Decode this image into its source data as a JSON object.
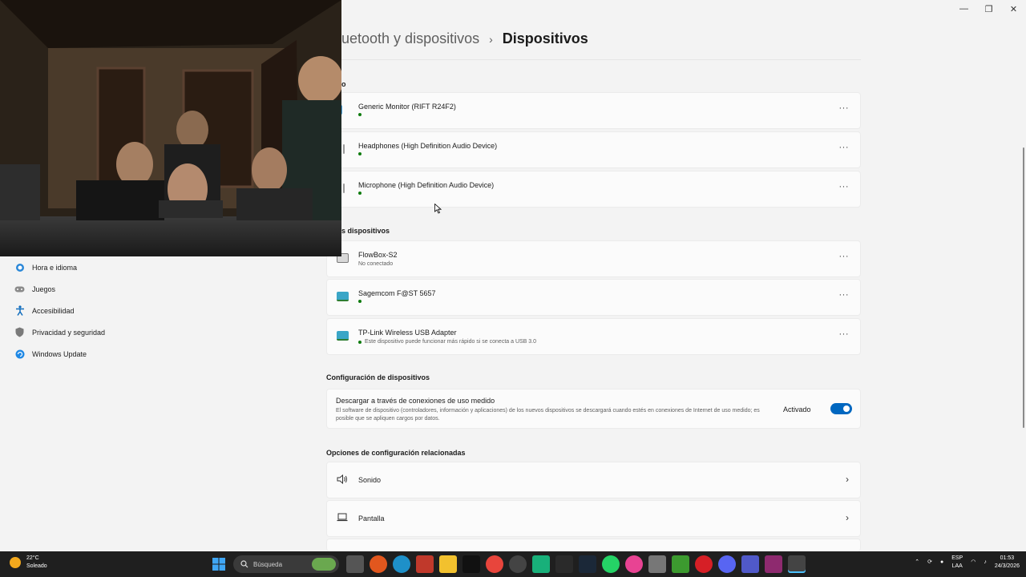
{
  "window": {
    "minimize": "—",
    "maximize": "❐",
    "close": "✕"
  },
  "breadcrumb": {
    "parent": "uetooth y dispositivos",
    "separator": "›",
    "current": "Dispositivos"
  },
  "sidebar": {
    "items": [
      {
        "label": "Hora e idioma"
      },
      {
        "label": "Juegos"
      },
      {
        "label": "Accesibilidad"
      },
      {
        "label": "Privacidad y seguridad"
      },
      {
        "label": "Windows Update"
      }
    ]
  },
  "audio": {
    "section_fragment": "o",
    "devices": [
      {
        "name": "Generic Monitor (RIFT R24F2)",
        "status": ""
      },
      {
        "name": "Headphones (High Definition Audio Device)",
        "status": ""
      },
      {
        "name": "Microphone (High Definition Audio Device)",
        "status": ""
      }
    ]
  },
  "other": {
    "section_fragment": "s dispositivos",
    "devices": [
      {
        "name": "FlowBox-S2",
        "status": "No conectado"
      },
      {
        "name": "Sagemcom F@ST 5657",
        "status": ""
      },
      {
        "name": "TP-Link Wireless USB Adapter",
        "status": "Este dispositivo puede funcionar más rápido si se conecta a USB 3.0"
      }
    ]
  },
  "device_config": {
    "heading": "Configuración de dispositivos",
    "title": "Descargar a través de conexiones de uso medido",
    "description": "El software de dispositivo (controladores, información y aplicaciones) de los nuevos dispositivos se descargará cuando estés en conexiones de Internet de uso medido; es posible que se apliquen cargos por datos.",
    "state_label": "Activado",
    "enabled": true
  },
  "related": {
    "heading": "Opciones de configuración relacionadas",
    "items": [
      {
        "label": "Sonido"
      },
      {
        "label": "Pantalla"
      }
    ]
  },
  "taskbar": {
    "weather_temp": "22°C",
    "weather_desc": "Soleado",
    "search_placeholder": "Búsqueda",
    "lang_line1": "ESP",
    "lang_line2": "LAA",
    "time": "01:53",
    "date": "24/3/2026"
  },
  "colors": {
    "accent": "#0067c0",
    "status_green": "#0f7b0f",
    "taskbar": "#1f1f1f"
  }
}
